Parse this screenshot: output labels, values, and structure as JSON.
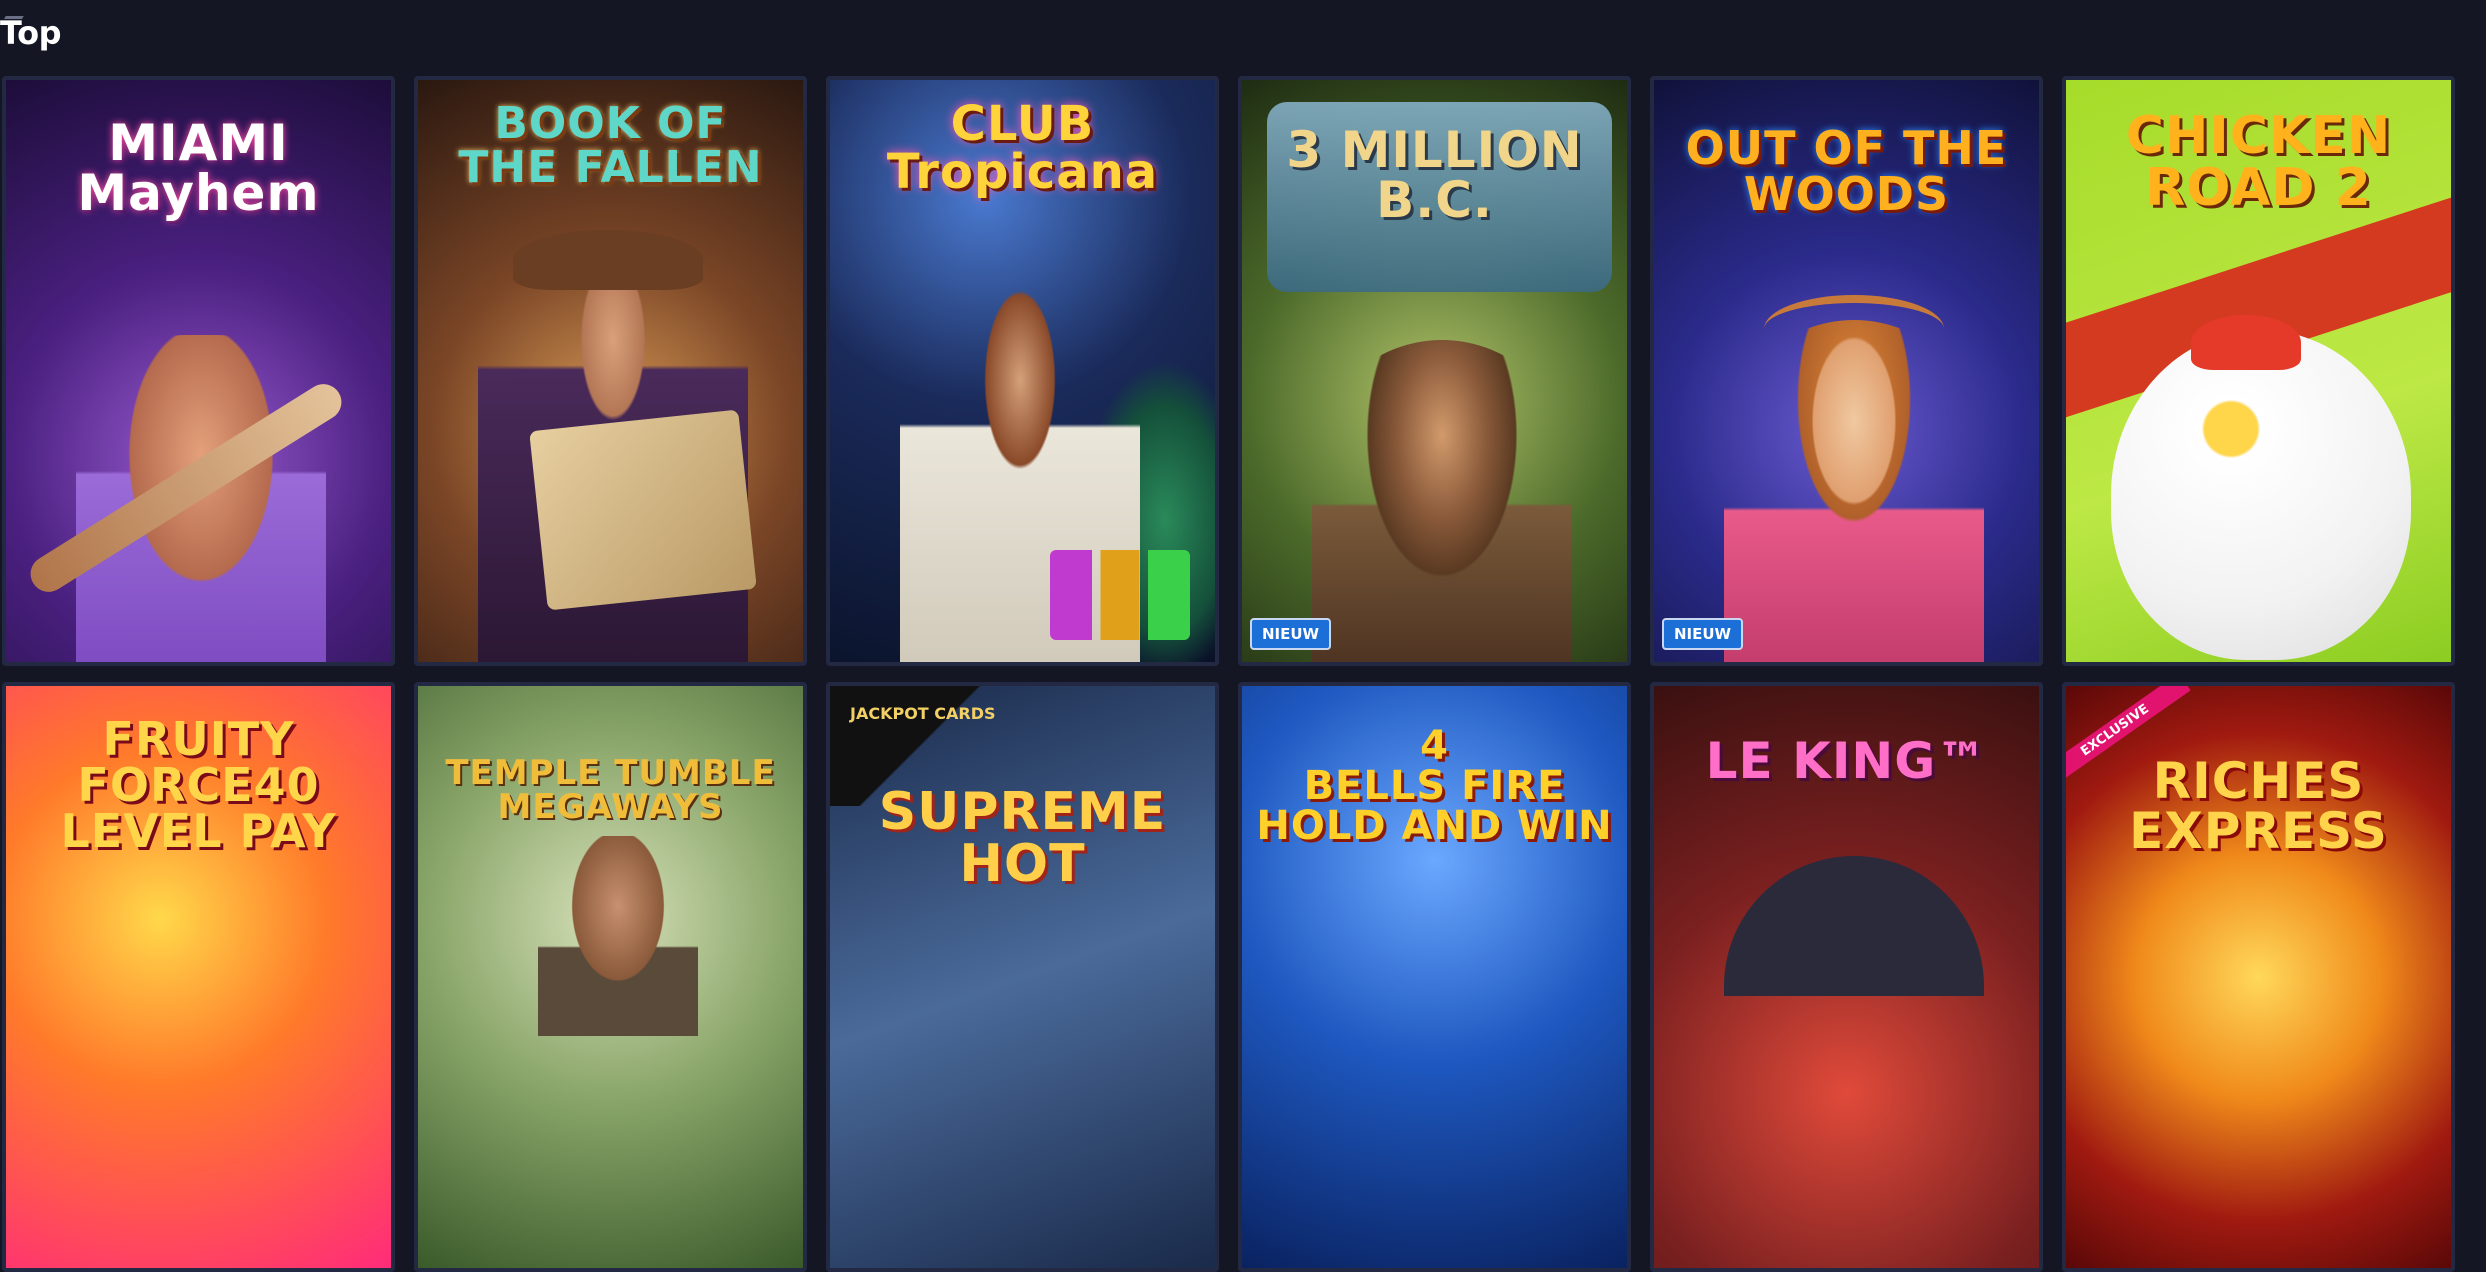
{
  "section": {
    "title": "Top"
  },
  "games": [
    {
      "name": "Miami Mayhem",
      "logo": "MIAMI\nMayhem",
      "badge": "",
      "exclusive": "",
      "jackpot": "",
      "colors": {
        "bg1": "#2a1450",
        "bg2": "#7c3db0",
        "logo": "#ffffff",
        "logo_accent": "#ff4fa3"
      }
    },
    {
      "name": "Book of the Fallen",
      "logo": "BOOK OF\nTHE FALLEN",
      "badge": "",
      "exclusive": "",
      "jackpot": "",
      "colors": {
        "bg1": "#3a2418",
        "bg2": "#a4643a",
        "logo": "#5fd7c8",
        "logo_accent": "#f0c36a"
      }
    },
    {
      "name": "Club Tropicana",
      "logo": "CLUB\nTropicana",
      "badge": "",
      "exclusive": "",
      "jackpot": "",
      "colors": {
        "bg1": "#0d1a3a",
        "bg2": "#2a4c8a",
        "logo": "#ffd33a",
        "logo_accent": "#ff5ab8"
      }
    },
    {
      "name": "3 Million B.C.",
      "logo": "3 MILLION\nB.C.",
      "badge": "NIEUW",
      "exclusive": "",
      "jackpot": "",
      "colors": {
        "bg1": "#2d4b1c",
        "bg2": "#8fb04c",
        "logo": "#f0d58a",
        "logo_accent": "#7ab6d6"
      }
    },
    {
      "name": "Out of the Woods",
      "logo": "OUT OF THE\nWOODS",
      "badge": "NIEUW",
      "exclusive": "",
      "jackpot": "",
      "colors": {
        "bg1": "#1b1e5a",
        "bg2": "#4b3fa8",
        "logo": "#ffb01f",
        "logo_accent": "#ff6a1a"
      }
    },
    {
      "name": "Chicken Road 2",
      "logo": "CHICKEN\nROAD 2",
      "badge": "",
      "exclusive": "",
      "jackpot": "",
      "colors": {
        "bg1": "#8fd62c",
        "bg2": "#c9ee55",
        "logo": "#ffb21c",
        "logo_accent": "#d8321f"
      }
    },
    {
      "name": "Fruity Force 40",
      "logo": "FRUITY\nFORCE40\nLEVEL PAY",
      "badge": "",
      "exclusive": "",
      "jackpot": "",
      "colors": {
        "bg1": "#ff2b6a",
        "bg2": "#ffb01f",
        "logo": "#ffd54a",
        "logo_accent": "#b01020"
      }
    },
    {
      "name": "Temple Tumble Megaways",
      "logo": "TEMPLE TUMBLE\nMEGAWAYS",
      "badge": "",
      "exclusive": "",
      "jackpot": "",
      "colors": {
        "bg1": "#4c6a32",
        "bg2": "#b5c48c",
        "logo": "#f0bd3a",
        "logo_accent": "#7a4a12"
      }
    },
    {
      "name": "Supreme Hot",
      "logo": "SUPREME\nHOT",
      "badge": "",
      "exclusive": "",
      "jackpot": "JACKPOT\nCARDS",
      "colors": {
        "bg1": "#1b2a4a",
        "bg2": "#5c7aa8",
        "logo": "#ffcf4a",
        "logo_accent": "#d6461c"
      }
    },
    {
      "name": "4 Bells Fire Hold and Win",
      "logo": "4\nBELLS FIRE\nHOLD AND WIN",
      "badge": "",
      "exclusive": "",
      "jackpot": "",
      "colors": {
        "bg1": "#0d2a6a",
        "bg2": "#2f7ae0",
        "logo": "#ffcf2a",
        "logo_accent": "#e03a1a"
      }
    },
    {
      "name": "Le King",
      "logo": "LE KING™",
      "badge": "",
      "exclusive": "",
      "jackpot": "",
      "colors": {
        "bg1": "#4a1a1a",
        "bg2": "#c0382a",
        "logo": "#ff6fc8",
        "logo_accent": "#ffcf2a"
      }
    },
    {
      "name": "Riches Express",
      "logo": "RICHES\nEXPRESS",
      "badge": "",
      "exclusive": "EXCLUSIVE",
      "jackpot": "",
      "colors": {
        "bg1": "#6a0f10",
        "bg2": "#f0a82a",
        "logo": "#ffd34a",
        "logo_accent": "#c0181a"
      }
    }
  ]
}
